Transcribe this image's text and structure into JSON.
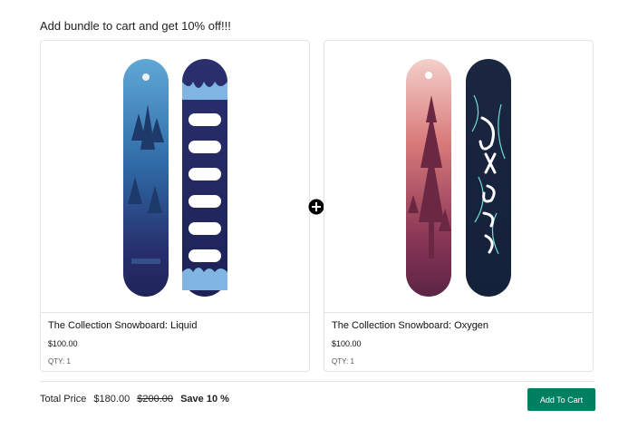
{
  "bundle": {
    "heading": "Add bundle to cart and get 10% off!!!"
  },
  "products": [
    {
      "title": "The Collection Snowboard: Liquid",
      "price": "$100.00",
      "qty_label": "QTY:",
      "qty": "1"
    },
    {
      "title": "The Collection Snowboard: Oxygen",
      "price": "$100.00",
      "qty_label": "QTY:",
      "qty": "1"
    }
  ],
  "summary": {
    "total_label": "Total Price",
    "total_price": "$180.00",
    "original_price": "$200.00",
    "savings": "Save 10 %"
  },
  "actions": {
    "add_to_cart": "Add To Cart"
  },
  "colors": {
    "button": "#008060",
    "border": "#e1e3e5"
  },
  "icons": {
    "bundle_plus": "plus-circle-icon"
  }
}
